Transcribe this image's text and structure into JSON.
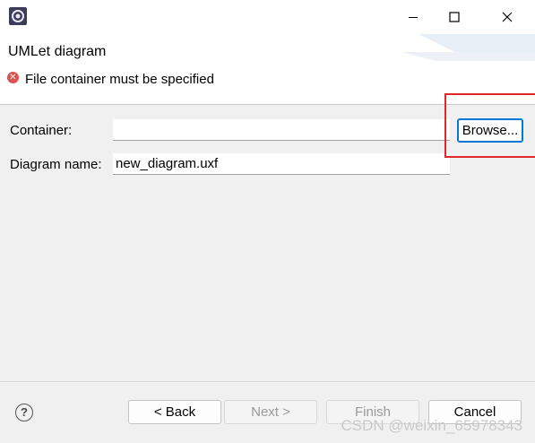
{
  "window": {
    "title": "",
    "icon": "eclipse-app-icon"
  },
  "header": {
    "title": "UMLet diagram",
    "message": "File container must be specified",
    "message_icon": "error-icon"
  },
  "form": {
    "container_label": "Container:",
    "container_value": "",
    "browse_label": "Browse...",
    "diagram_name_label": "Diagram name:",
    "diagram_name_value": "new_diagram.uxf"
  },
  "footer": {
    "back_label": "< Back",
    "next_label": "Next >",
    "finish_label": "Finish",
    "cancel_label": "Cancel"
  },
  "watermark": "CSDN @weixin_65978343",
  "colors": {
    "accent": "#0078d4",
    "highlight": "#e12828",
    "error": "#d9534f"
  }
}
